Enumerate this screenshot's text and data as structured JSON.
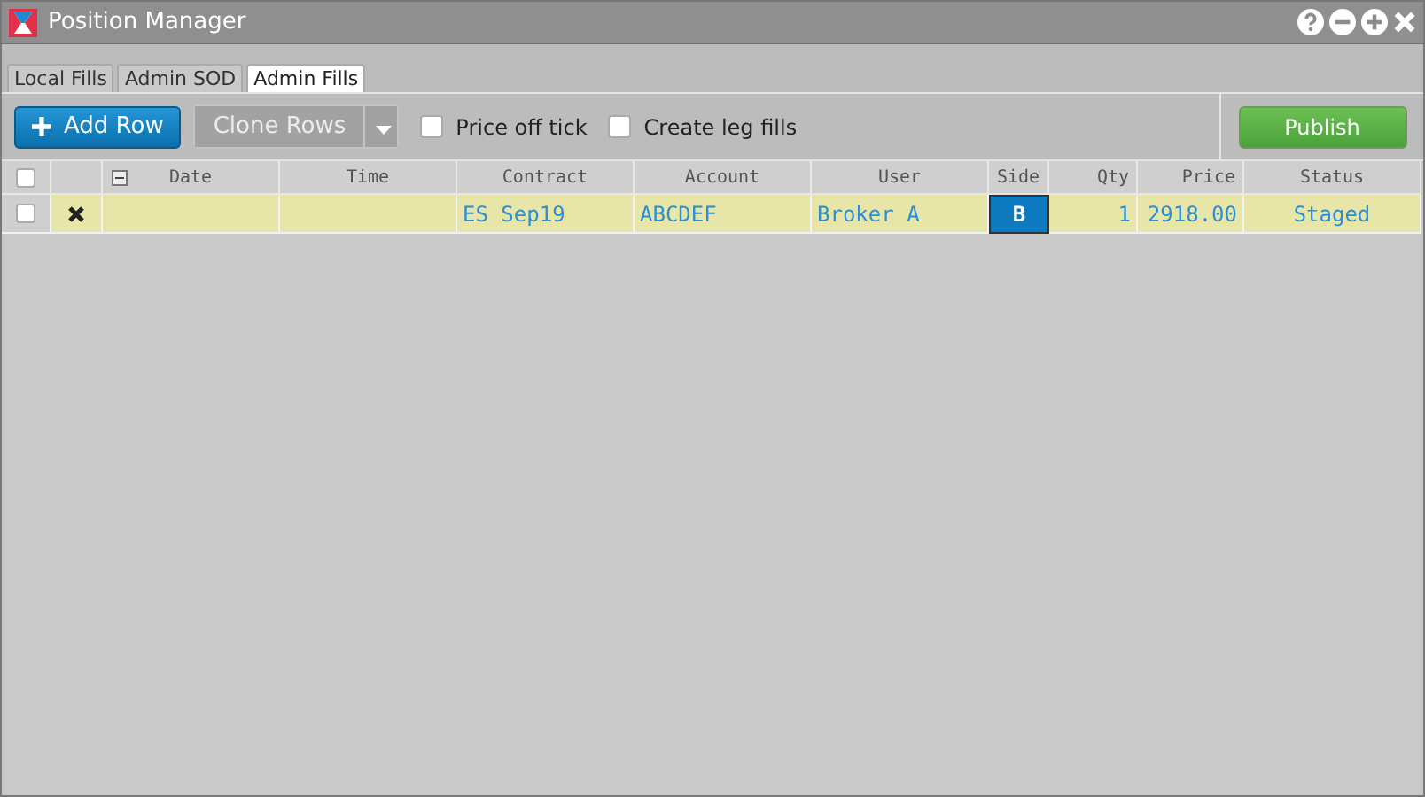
{
  "window": {
    "title": "Position Manager"
  },
  "tabs": [
    {
      "label": "Local Fills",
      "selected": false
    },
    {
      "label": "Admin SOD",
      "selected": false
    },
    {
      "label": "Admin Fills",
      "selected": true
    }
  ],
  "toolbar": {
    "add_button": {
      "label": "Add Row",
      "disabled": false
    },
    "clone_button": {
      "label": "Clone Rows",
      "disabled": true
    },
    "options": [
      {
        "label": "Price off tick",
        "checked": false
      },
      {
        "label": "Create leg fills",
        "checked": false
      }
    ],
    "publish_button": {
      "label": "Publish",
      "disabled": false
    }
  },
  "table": {
    "all_checked": false,
    "columns": [
      {
        "label": "Date"
      },
      {
        "label": "Time"
      },
      {
        "label": "Contract"
      },
      {
        "label": "Account"
      },
      {
        "label": "User"
      },
      {
        "label": "Side"
      },
      {
        "label": "Qty"
      },
      {
        "label": "Price"
      },
      {
        "label": "Status"
      }
    ],
    "rows": [
      {
        "checked": false,
        "cells": [
          null,
          null,
          {
            "text": "ES Sep19",
            "selected": false
          },
          {
            "text": "ABCDEF",
            "selected": false
          },
          {
            "text": "Broker A",
            "selected": false
          },
          {
            "text": "B",
            "selected": true
          },
          {
            "text": "1",
            "selected": false
          },
          {
            "text": "2918.00",
            "selected": false
          },
          {
            "text": "Staged",
            "selected": false
          }
        ]
      }
    ]
  }
}
